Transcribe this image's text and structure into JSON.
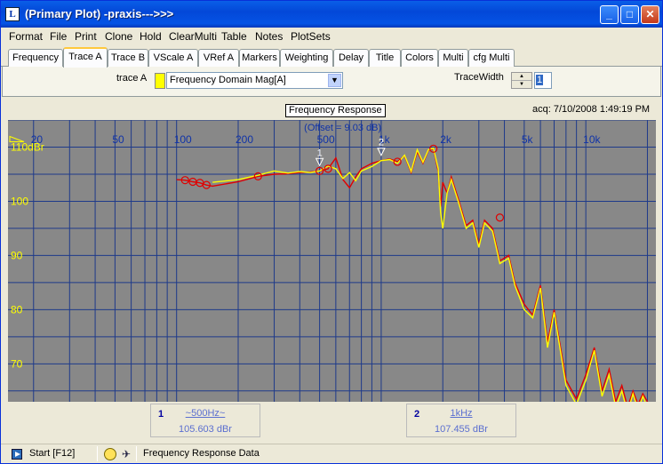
{
  "window": {
    "title": "(Primary Plot) -praxis--->>>",
    "app_icon_letter": "L"
  },
  "menu": [
    "Format",
    "File",
    "Print",
    "Clone",
    "Hold",
    "ClearMulti",
    "Table",
    "Notes",
    "PlotSets"
  ],
  "tabs": [
    "Frequency",
    "Trace A",
    "Trace B",
    "VScale A",
    "VRef A",
    "Markers",
    "Weighting",
    "Delay",
    "Title",
    "Colors",
    "Multi",
    "cfg Multi"
  ],
  "active_tab": "Trace A",
  "trace_panel": {
    "trace_label": "trace A",
    "trace_color": "#FFFF00",
    "trace_select_value": "Frequency Domain Mag[A]",
    "trace_width_label": "TraceWidth",
    "trace_width_value": "1"
  },
  "plot": {
    "title": "Frequency Response",
    "offset_text": "(Offset = 9.03 dB)",
    "acq_text": "acq: 7/10/2008 1:49:19 PM",
    "ref_label": "110dBr",
    "markers": [
      {
        "index": "1",
        "freq": "~500Hz~",
        "value": "105.603 dBr"
      },
      {
        "index": "2",
        "freq": "1kHz",
        "value": "107.455 dBr"
      }
    ]
  },
  "chart_data": {
    "type": "line",
    "title": "Frequency Response",
    "x_scale": "log",
    "xlim": [
      15,
      22000
    ],
    "ylim": [
      63,
      115
    ],
    "x_ticks": [
      20,
      50,
      100,
      200,
      500,
      1000,
      2000,
      5000,
      10000
    ],
    "x_tick_labels": [
      "20",
      "50",
      "100",
      "200",
      "500",
      "1k",
      "2k",
      "5k",
      "10k"
    ],
    "y_ticks": [
      110,
      100,
      90,
      80,
      70
    ],
    "y_tick_labels": [
      "110dBr",
      "100",
      "90",
      "80",
      "70"
    ],
    "grid": true,
    "series": [
      {
        "color": "#FFFF00",
        "x": [
          150,
          200,
          250,
          300,
          350,
          400,
          450,
          500,
          550,
          600,
          650,
          700,
          750,
          800,
          900,
          1000,
          1100,
          1200,
          1300,
          1400,
          1500,
          1600,
          1700,
          1800,
          1900,
          1950,
          2000,
          2100,
          2200,
          2400,
          2600,
          2800,
          3000,
          3200,
          3500,
          3800,
          4200,
          4500,
          5000,
          5500,
          6000,
          6500,
          7000,
          8000,
          9000,
          10000,
          11000,
          12000,
          13000,
          14000,
          15000,
          16000,
          17000,
          18000,
          19000,
          20000
        ],
        "y": [
          103.5,
          104.0,
          104.8,
          105.6,
          105.2,
          105.5,
          105.3,
          105.6,
          106.5,
          106.0,
          104.2,
          105.3,
          103.8,
          105.6,
          106.4,
          107.5,
          107.7,
          107.0,
          108.5,
          105.5,
          109.5,
          107.2,
          109.5,
          109.8,
          106.0,
          98.0,
          95.0,
          101.5,
          104.0,
          99.5,
          95.0,
          96.0,
          91.5,
          96.0,
          94.5,
          88.5,
          89.5,
          84.5,
          80.0,
          78.5,
          84.0,
          73.0,
          79.5,
          66.0,
          62.5,
          67.0,
          72.5,
          64.0,
          68.0,
          62.0,
          65.0,
          61.0,
          64.5,
          61.5,
          64.0,
          62.0
        ]
      },
      {
        "color": "#E00000",
        "x": [
          100,
          110,
          120,
          130,
          140,
          150,
          200,
          250,
          300,
          350,
          400,
          450,
          500,
          550,
          600,
          650,
          700,
          750,
          800,
          900,
          1000,
          1100,
          1200,
          1300,
          1400,
          1500,
          1600,
          1700,
          1800,
          1900,
          1950,
          2000,
          2100,
          2200,
          2400,
          2600,
          2800,
          3000,
          3200,
          3500,
          3800,
          4200,
          4500,
          5000,
          5500,
          6000,
          6500,
          7000,
          8000,
          9000,
          10000,
          11000,
          12000,
          13000,
          14000,
          15000,
          16000,
          17000,
          18000,
          19000,
          20000
        ],
        "y": [
          104.0,
          103.9,
          103.6,
          103.4,
          103.0,
          102.8,
          103.6,
          104.6,
          105.0,
          105.1,
          105.3,
          105.4,
          105.6,
          106.0,
          108.0,
          104.0,
          102.5,
          104.5,
          106.0,
          107.0,
          107.5,
          107.8,
          107.3,
          108.4,
          105.3,
          109.2,
          107.0,
          109.4,
          109.7,
          105.5,
          99.0,
          103.5,
          101.5,
          104.5,
          100.0,
          95.5,
          96.5,
          92.0,
          96.5,
          95.0,
          89.0,
          90.0,
          85.0,
          81.0,
          79.0,
          84.5,
          74.0,
          80.0,
          67.0,
          63.5,
          68.0,
          73.0,
          65.0,
          69.0,
          63.0,
          66.0,
          62.0,
          65.0,
          62.5,
          64.5,
          63.0
        ]
      }
    ],
    "circle_markers": {
      "x": [
        110,
        120,
        130,
        140,
        250,
        500,
        550,
        1200,
        1800,
        3800
      ],
      "y": [
        103.9,
        103.6,
        103.4,
        103.0,
        104.6,
        105.6,
        106.0,
        107.3,
        109.7,
        97.0
      ]
    },
    "marker_points": [
      {
        "label": "1",
        "x": 500,
        "y": 105.6
      },
      {
        "label": "2",
        "x": 1000,
        "y": 107.5
      }
    ]
  }
}
